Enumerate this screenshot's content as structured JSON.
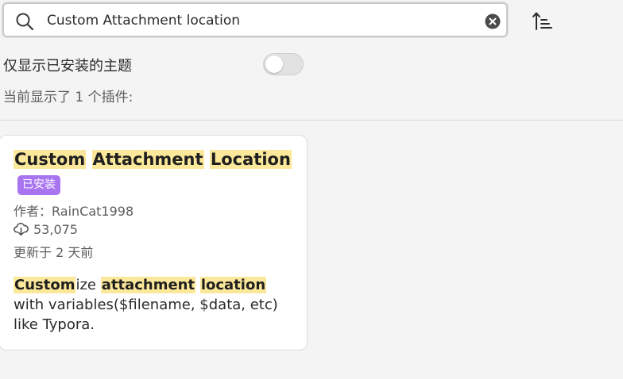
{
  "search": {
    "value": "Custom Attachment location",
    "icon": "search-icon",
    "clear_icon": "clear-icon"
  },
  "toolbar": {
    "sort_icon": "sort-icon"
  },
  "filter": {
    "installed_only_label": "仅显示已安装的主题",
    "installed_only_enabled": false
  },
  "results": {
    "count_label": "当前显示了 1 个插件:"
  },
  "plugins": [
    {
      "title_words": [
        "Custom",
        "Attachment",
        "Location"
      ],
      "badge": "已安装",
      "author": "作者：RainCat1998",
      "downloads": "53,075",
      "updated": "更新于 2 天前",
      "description": {
        "part1_hl": "Custom",
        "part2": "ize ",
        "part3_hl": "attachment",
        "part4": " ",
        "part5_hl": "location",
        "part6": " with variables($filename, $data, etc) like Typora."
      }
    }
  ],
  "colors": {
    "highlight": "#fce89a",
    "badge": "#a874f0",
    "background": "#f4f4f4"
  }
}
